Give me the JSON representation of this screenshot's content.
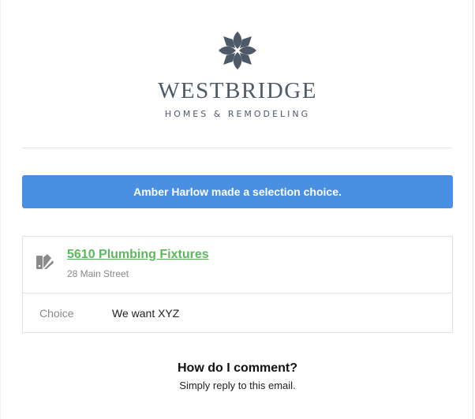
{
  "brand": {
    "name": "WESTBRIDGE",
    "tagline": "HOMES & REMODELING",
    "logo_icon": "flower-logo-icon",
    "color": "#4e5a68"
  },
  "banner": {
    "text": "Amber Harlow made a selection choice.",
    "color": "#4a90e2"
  },
  "item": {
    "icon": "swatch-icon",
    "title": "5610 Plumbing Fixtures",
    "address": "28 Main Street",
    "link_color": "#5cb85c"
  },
  "choice": {
    "label": "Choice",
    "value": "We want XYZ"
  },
  "footer": {
    "question": "How do I comment?",
    "answer": "Simply reply to this email."
  }
}
